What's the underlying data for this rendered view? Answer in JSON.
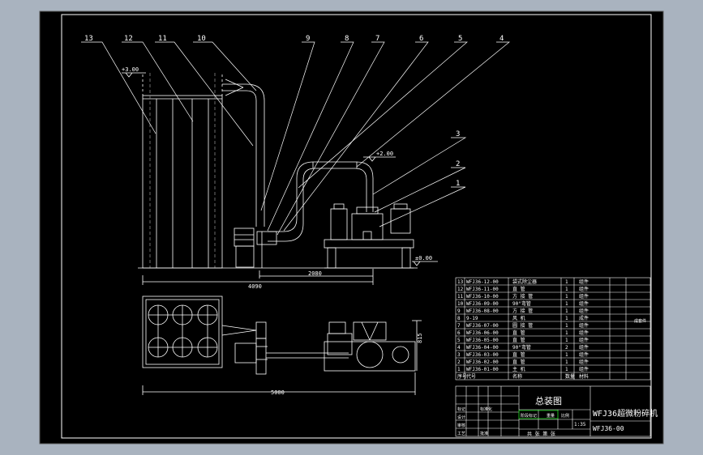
{
  "colors": {
    "background": "#a9b3bf",
    "sheet": "#000000",
    "line": "#ffffff",
    "accent_cyan": "#00ffff",
    "table_green": "#00c000",
    "table_yellow": "#ffff00"
  },
  "balloons": [
    "13",
    "12",
    "11",
    "10",
    "9",
    "8",
    "7",
    "6",
    "5",
    "4",
    "3",
    "2",
    "1"
  ],
  "dimensions": {
    "elev_top": "+3.00",
    "elev_mid": "+2.00",
    "elev_zero": "±0.00",
    "width_front": "4090",
    "width_span": "2080",
    "width_plan": "5000",
    "depth_plan": "815"
  },
  "parts_table": {
    "rows": [
      {
        "no": "13",
        "code": "WFJ36-12-00",
        "name": "袋式除尘器",
        "qty": "1",
        "mat": "组件"
      },
      {
        "no": "12",
        "code": "WFJ36-11-00",
        "name": "直 管",
        "qty": "1",
        "mat": "组件"
      },
      {
        "no": "11",
        "code": "WFJ36-10-00",
        "name": "方 接 管",
        "qty": "1",
        "mat": "组件"
      },
      {
        "no": "10",
        "code": "WFJ36-09-00",
        "name": "90°弯管",
        "qty": "1",
        "mat": "组件"
      },
      {
        "no": "9",
        "code": "WFJ36-08-00",
        "name": "方 接 管",
        "qty": "1",
        "mat": "组件"
      },
      {
        "no": "8",
        "code": "9-19",
        "name": "风 机",
        "qty": "1",
        "mat": "成件"
      },
      {
        "no": "7",
        "code": "WFJ36-07-00",
        "name": "圆 接 管",
        "qty": "1",
        "mat": "组件"
      },
      {
        "no": "6",
        "code": "WFJ36-06-00",
        "name": "直 管",
        "qty": "1",
        "mat": "组件"
      },
      {
        "no": "5",
        "code": "WFJ36-05-00",
        "name": "直 管",
        "qty": "1",
        "mat": "组件"
      },
      {
        "no": "4",
        "code": "WFJ36-04-00",
        "name": "90°弯管",
        "qty": "2",
        "mat": "组件"
      },
      {
        "no": "3",
        "code": "WFJ36-03-00",
        "name": "直 管",
        "qty": "1",
        "mat": "组件"
      },
      {
        "no": "2",
        "code": "WFJ36-02-00",
        "name": "直 管",
        "qty": "1",
        "mat": "组件"
      },
      {
        "no": "1",
        "code": "WFJ36-01-00",
        "name": "主 机",
        "qty": "1",
        "mat": "组件"
      }
    ],
    "header": {
      "no": "序号",
      "code": "代号",
      "name": "名称",
      "qty": "数量",
      "mat": "材料"
    },
    "side_note": "成套件"
  },
  "title_block": {
    "drawing_title": "总装图",
    "product_name": "WFJ36超微粉碎机",
    "drawing_code": "WFJ36-00",
    "scale": "1:35",
    "sheet_info": "共  张 第  张",
    "rows": [
      "标记",
      "设计",
      "审核",
      "工艺"
    ],
    "header_cells": [
      "阶段标记",
      "重量",
      "比例"
    ],
    "sign_cells": [
      "标准化",
      "批准"
    ]
  }
}
